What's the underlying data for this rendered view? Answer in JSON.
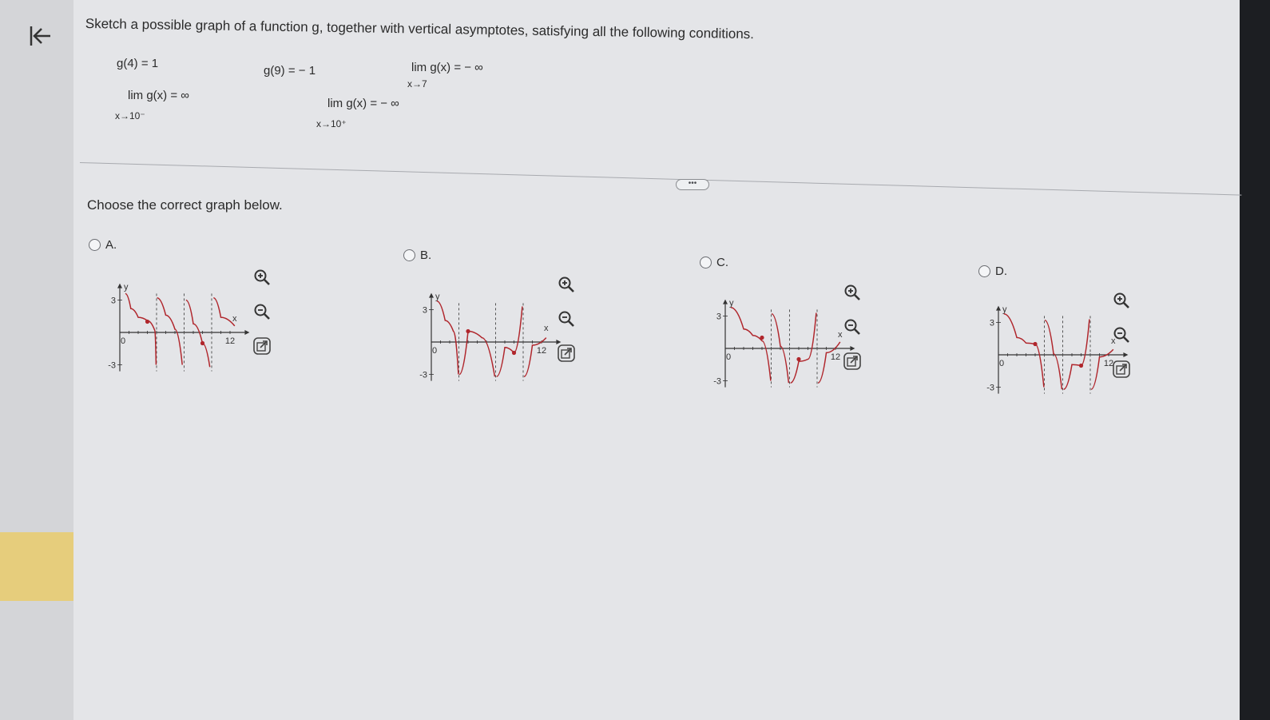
{
  "header": {
    "faint_text": "possible"
  },
  "question": {
    "prompt": "Sketch a possible graph of a function g, together with vertical asymptotes, satisfying all the following conditions.",
    "conditions": {
      "c1": "g(4) = 1",
      "c2": "g(9) = − 1",
      "c3_main": "lim  g(x) = − ∞",
      "c3_sub": "x→7",
      "c4_main": "lim  g(x) = ∞",
      "c4_sub": "x→10⁻",
      "c5_main": "lim  g(x) = − ∞",
      "c5_sub": "x→10⁺"
    },
    "more_label": "•••",
    "choose_label": "Choose the correct graph below."
  },
  "options": [
    {
      "letter": "A.",
      "y_top": "3",
      "y_bottom": "-3",
      "y_axis": "y",
      "x_axis": "x",
      "x_max": "12",
      "origin": "0"
    },
    {
      "letter": "B.",
      "y_top": "3",
      "y_bottom": "-3",
      "y_axis": "y",
      "x_axis": "x",
      "x_max": "12",
      "origin": "0"
    },
    {
      "letter": "C.",
      "y_top": "3",
      "y_bottom": "-3",
      "y_axis": "y",
      "x_axis": "x",
      "x_max": "12",
      "origin": "0"
    },
    {
      "letter": "D.",
      "y_top": "3",
      "y_bottom": "-3",
      "y_axis": "y",
      "x_axis": "x",
      "x_max": "12",
      "origin": "0"
    }
  ],
  "icons": {
    "back": "back-to-start-icon",
    "zoom_in": "zoom-in-icon",
    "zoom_out": "zoom-out-icon",
    "popout": "external-link-icon"
  },
  "colors": {
    "curve": "#b0262c",
    "asymptote": "#555555",
    "axis": "#333333",
    "topbar": "#2f6a5c",
    "highlight": "#2fe0a0"
  }
}
